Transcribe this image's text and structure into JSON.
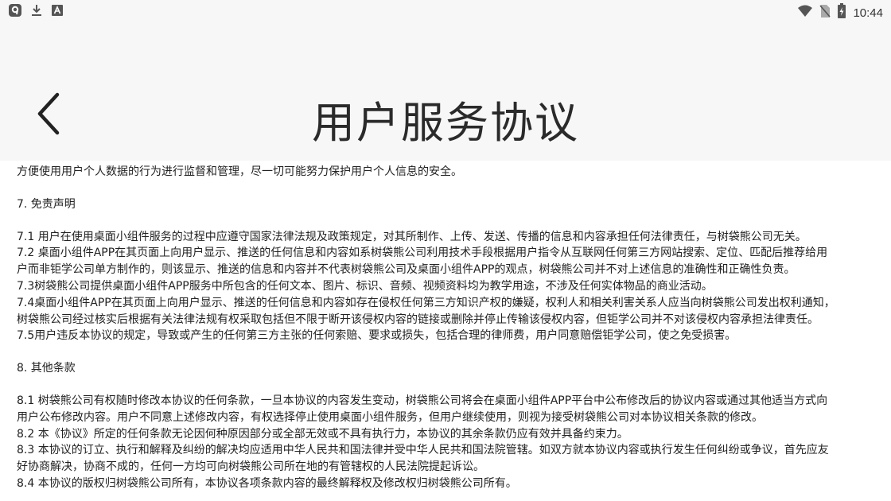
{
  "status_bar": {
    "time": "10:44",
    "left_icons": [
      "app-notification-icon",
      "download-icon",
      "keyboard-icon"
    ],
    "right_icons": [
      "wifi-icon",
      "no-sim-icon",
      "battery-charging-icon"
    ]
  },
  "header": {
    "title": "用户服务协议",
    "back_icon": "chevron-left-icon"
  },
  "content": {
    "lines": [
      "方便使用用户个人数据的行为进行监督和管理，尽一切可能努力保护用户个人信息的安全。",
      "",
      "7. 免责声明",
      "",
      "7.1 用户在使用桌面小组件服务的过程中应遵守国家法律法规及政策规定，对其所制作、上传、发送、传播的信息和内容承担任何法律责任，与树袋熊公司无关。",
      "7.2 桌面小组件APP在其页面上向用户显示、推送的任何信息和内容如系树袋熊公司利用技术手段根据用户指令从互联网任何第三方网站搜索、定位、匹配后推荐给用",
      "户而非钜学公司单方制作的，则该显示、推送的信息和内容并不代表树袋熊公司及桌面小组件APP的观点，树袋熊公司并不对上述信息的准确性和正确性负责。",
      "7.3树袋熊公司提供桌面小组件APP服务中所包含的任何文本、图片、标识、音频、视频资料均为教学用途，不涉及任何实体物品的商业活动。",
      "7.4桌面小组件APP在其页面上向用户显示、推送的任何信息和内容如存在侵权任何第三方知识产权的嫌疑，权利人和相关利害关系人应当向树袋熊公司发出权利通知，",
      "树袋熊公司经过核实后根据有关法律法规有权采取包括但不限于断开该侵权内容的链接或删除并停止传输该侵权内容，但钜学公司并不对该侵权内容承担法律责任。",
      "7.5用户违反本协议的规定，导致或产生的任何第三方主张的任何索赔、要求或损失，包括合理的律师费，用户同意赔偿钜学公司，使之免受损害。",
      "",
      "8. 其他条款",
      "",
      "8.1 树袋熊公司有权随时修改本协议的任何条款，一旦本协议的内容发生变动，树袋熊公司将会在桌面小组件APP平台中公布修改后的协议内容或通过其他适当方式向",
      "用户公布修改内容。用户不同意上述修改内容，有权选择停止使用桌面小组件服务，但用户继续使用，则视为接受树袋熊公司对本协议相关条款的修改。",
      "8.2 本《协议》所定的任何条款无论因何种原因部分或全部无效或不具有执行力，本协议的其余条款仍应有效并具备约束力。",
      "8.3 本协议的订立、执行和解释及纠纷的解决均应适用中华人民共和国法律并受中华人民共和国法院管辖。如双方就本协议内容或执行发生任何纠纷或争议，首先应友",
      "好协商解决，协商不成的，任何一方均可向树袋熊公司所在地的有管辖权的人民法院提起诉讼。",
      "8.4 本协议的版权归树袋熊公司所有，本协议各项条款内容的最终解释权及修改权归树袋熊公司所有。"
    ]
  }
}
